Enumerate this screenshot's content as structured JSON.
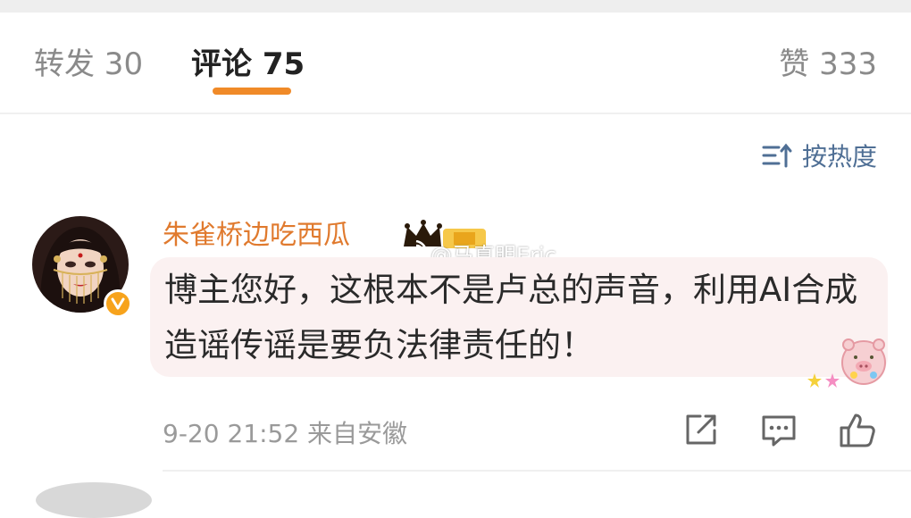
{
  "tabs": {
    "repost": "转发 30",
    "comments": "评论 75",
    "likes": "赞 333"
  },
  "sort": {
    "label": "按热度",
    "icon": "sort-icon"
  },
  "comment": {
    "username": "朱雀桥边吃西瓜",
    "watermark": "@马真明Eric",
    "text": "博主您好，这根本不是卢总的声音，利用AI合成造谣传谣是要负法律责任的！",
    "meta": "9-20 21:52 来自安徽",
    "actions": [
      "share-icon",
      "reply-icon",
      "like-icon"
    ]
  },
  "colors": {
    "accent": "#f08a28",
    "username": "#e07a2e",
    "link": "#4f6f95",
    "bubble": "#fbf1f1"
  }
}
